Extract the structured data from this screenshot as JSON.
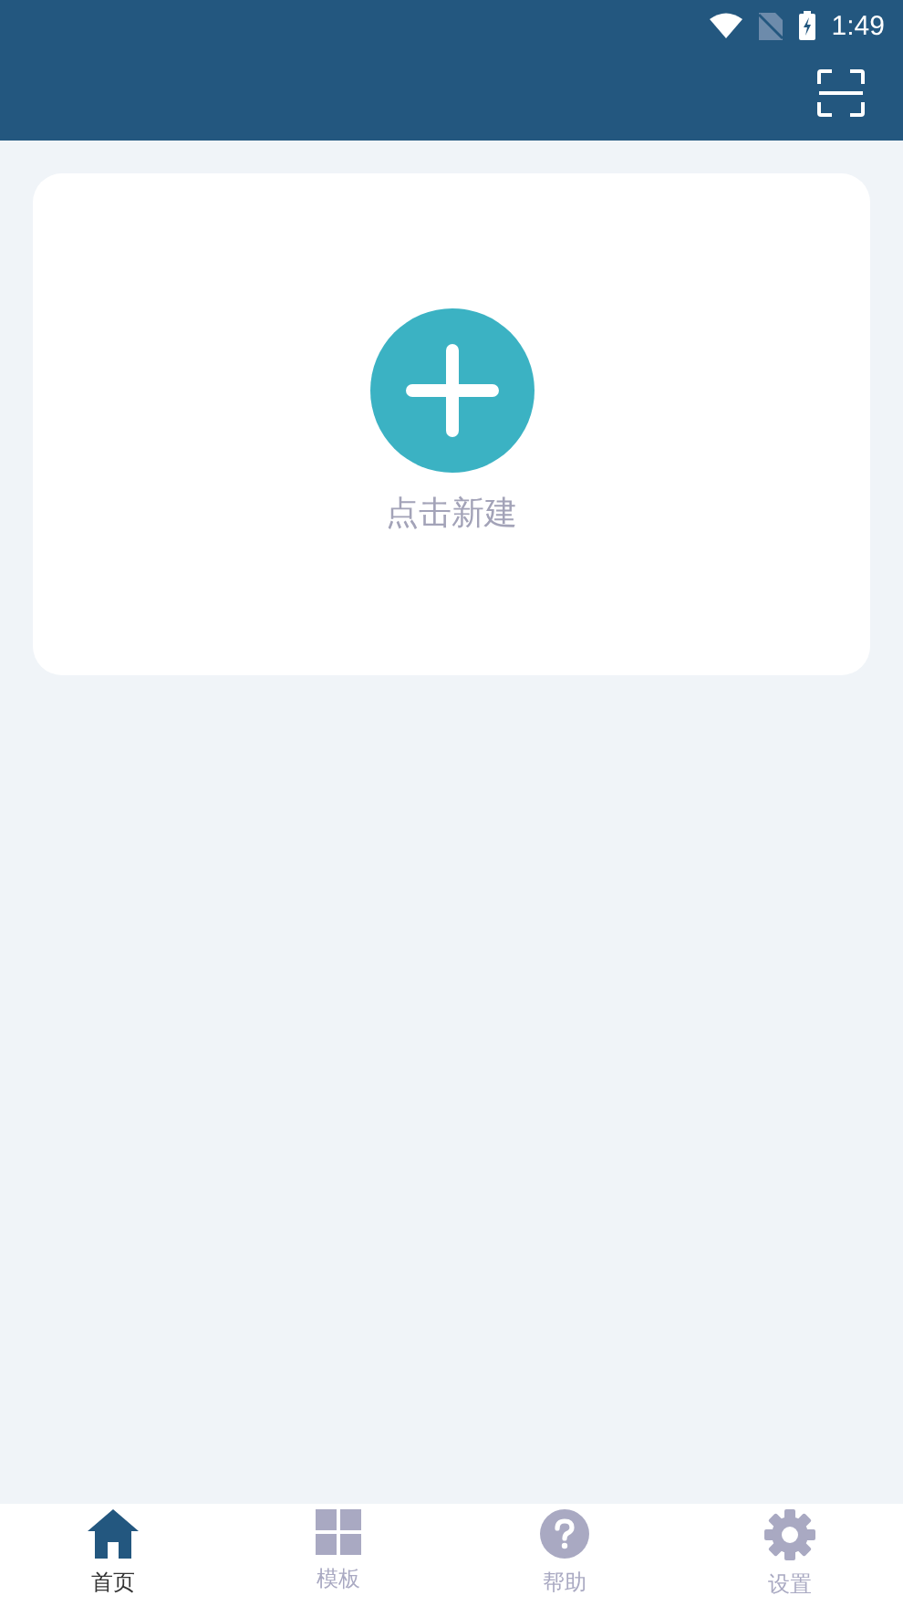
{
  "status_bar": {
    "time": "1:49"
  },
  "card": {
    "label": "点击新建"
  },
  "tabs": [
    {
      "kind": "home",
      "label": "首页",
      "selected": true
    },
    {
      "kind": "grid",
      "label": "模板",
      "selected": false
    },
    {
      "kind": "help",
      "label": "帮助",
      "selected": false
    },
    {
      "kind": "settings",
      "label": "设置",
      "selected": false
    }
  ]
}
